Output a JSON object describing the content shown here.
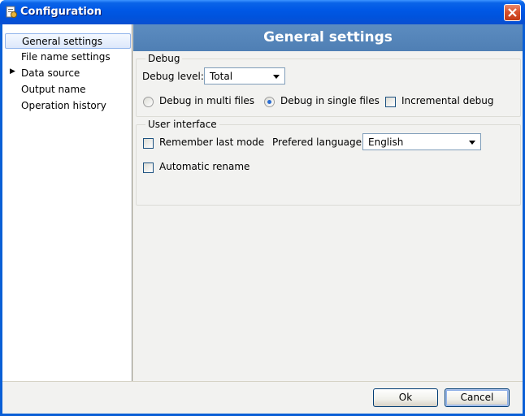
{
  "window": {
    "title": "Configuration"
  },
  "sidebar": {
    "items": [
      {
        "label": "General settings",
        "selected": true,
        "expandable": false
      },
      {
        "label": "File name settings",
        "selected": false,
        "expandable": false
      },
      {
        "label": "Data source",
        "selected": false,
        "expandable": true
      },
      {
        "label": "Output name",
        "selected": false,
        "expandable": false
      },
      {
        "label": "Operation history",
        "selected": false,
        "expandable": false
      }
    ]
  },
  "panel": {
    "title": "General settings",
    "debug": {
      "group_title": "Debug",
      "level_label": "Debug level:",
      "level_value": "Total",
      "multi_files_label": "Debug in multi files",
      "multi_files_selected": false,
      "single_files_label": "Debug in single files",
      "single_files_selected": true,
      "incremental_label": "Incremental debug",
      "incremental_checked": false
    },
    "ui": {
      "group_title": "User interface",
      "remember_label": "Remember last mode",
      "remember_checked": false,
      "language_label": "Prefered language:",
      "language_value": "English",
      "rename_label": "Automatic rename",
      "rename_checked": false
    }
  },
  "footer": {
    "ok_label": "Ok",
    "cancel_label": "Cancel"
  },
  "colors": {
    "titlebar": "#0058e6",
    "panel_header": "#5585ba",
    "selected_item_border": "#8fb3eb"
  }
}
